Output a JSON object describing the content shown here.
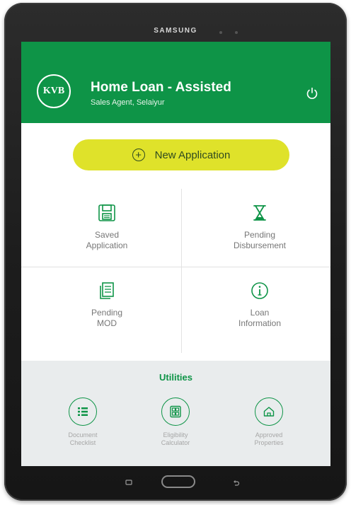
{
  "device": {
    "brand": "SAMSUNG"
  },
  "header": {
    "logo_text": "KVB",
    "title": "Home Loan - Assisted",
    "subtitle": "Sales Agent, Selaiyur"
  },
  "new_application": {
    "label": "New Application"
  },
  "tiles": {
    "saved_application": [
      "Saved",
      "Application"
    ],
    "pending_disbursement": [
      "Pending",
      "Disbursement"
    ],
    "pending_mod": [
      "Pending",
      "MOD"
    ],
    "loan_information": [
      "Loan",
      "Information"
    ]
  },
  "utilities": {
    "title": "Utilities",
    "items": [
      {
        "line1": "Document",
        "line2": "Checklist",
        "icon": "list-icon"
      },
      {
        "line1": "Eligibility",
        "line2": "Calculator",
        "icon": "calculator-icon"
      },
      {
        "line1": "Approved",
        "line2": "Properties",
        "icon": "home-icon"
      }
    ]
  },
  "colors": {
    "brand_green": "#0e9447",
    "accent_yellow": "#dfe22a",
    "utilities_bg": "#e9eced"
  }
}
